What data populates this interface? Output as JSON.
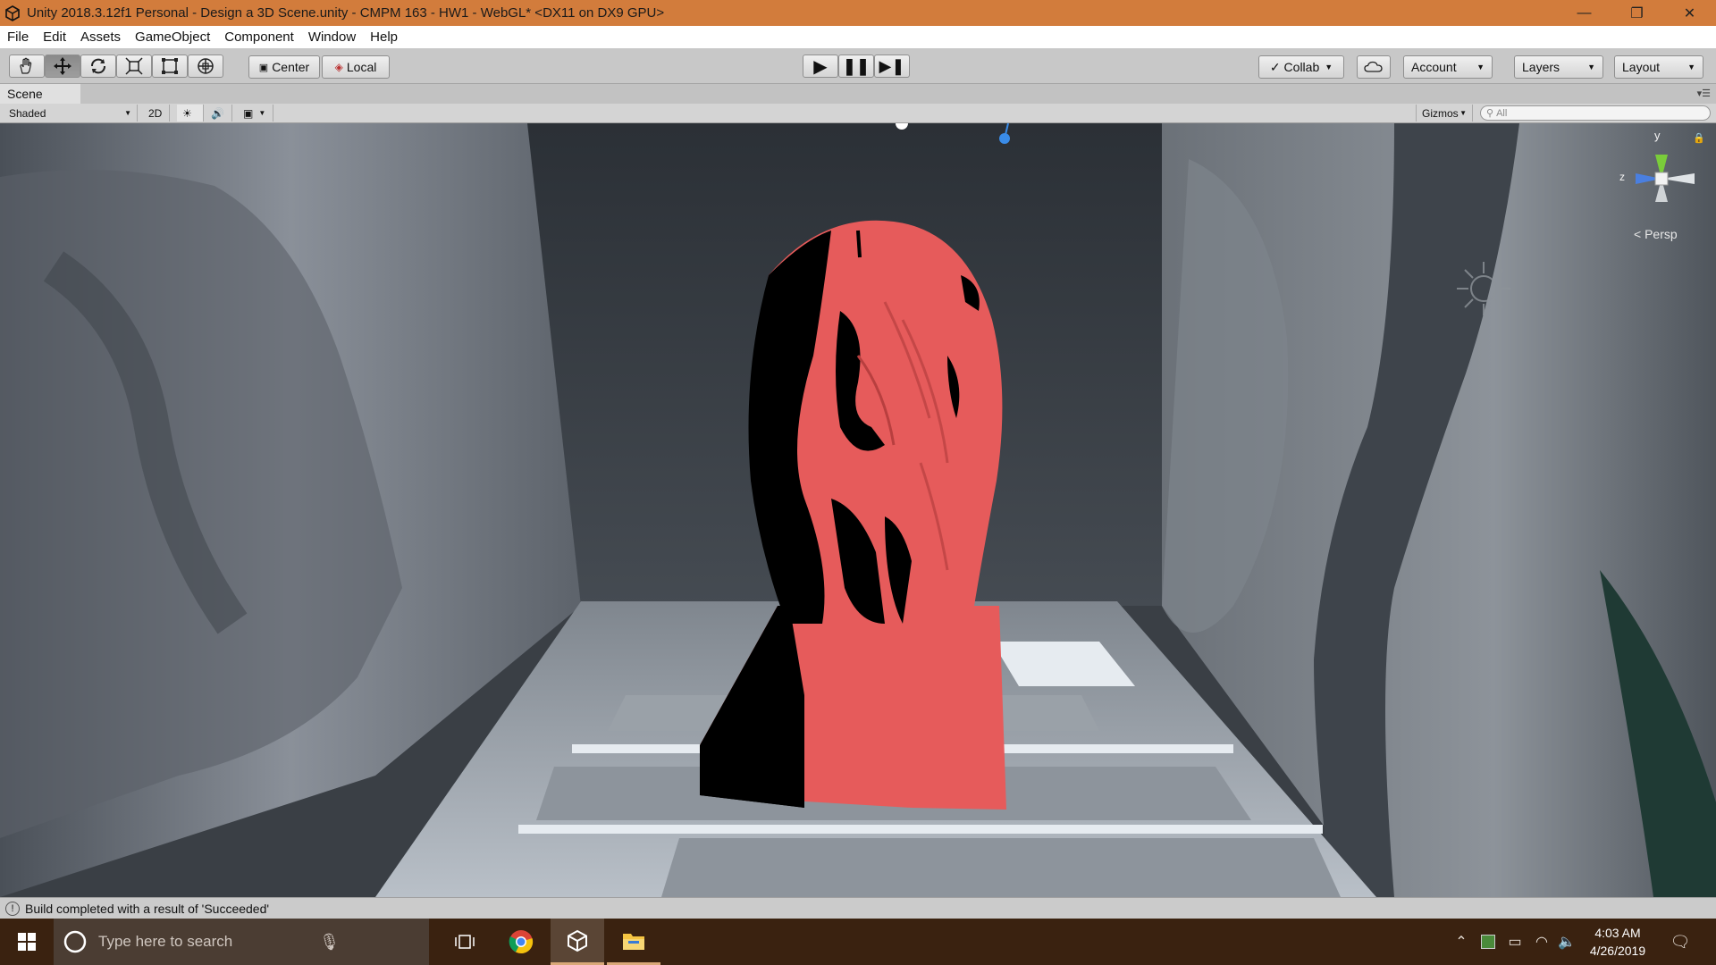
{
  "window": {
    "title": "Unity 2018.3.12f1 Personal - Design a 3D Scene.unity - CMPM 163 - HW1 - WebGL* <DX11 on DX9 GPU>",
    "minimize": "—",
    "restore": "❐",
    "close": "✕"
  },
  "menu": [
    "File",
    "Edit",
    "Assets",
    "GameObject",
    "Component",
    "Window",
    "Help"
  ],
  "toolbar": {
    "pivot_label": "Center",
    "space_label": "Local",
    "collab_label": "Collab",
    "account_label": "Account",
    "layers_label": "Layers",
    "layout_label": "Layout"
  },
  "scene": {
    "tab_label": "Scene",
    "shading_mode": "Shaded",
    "mode_2d": "2D",
    "gizmos_label": "Gizmos",
    "search_placeholder": "All",
    "projection_label": "Persp",
    "axis_y": "y",
    "axis_z": "z"
  },
  "status": {
    "message": "Build completed with a result of 'Succeeded'"
  },
  "taskbar": {
    "search_placeholder": "Type here to search",
    "time": "4:03 AM",
    "date": "4/26/2019"
  },
  "colors": {
    "titlebar": "#d27c3c",
    "statue": "#e85a5a",
    "taskbar": "#3a2210"
  }
}
